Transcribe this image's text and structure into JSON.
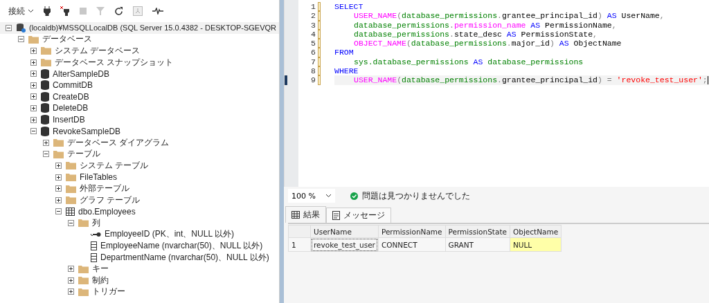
{
  "toolbar": {
    "connect_label": "接続"
  },
  "tree": [
    {
      "label": "(localdb)¥MSSQLLocalDB (SQL Server 15.0.4382 - DESKTOP-SGEVQR",
      "kind": "server",
      "expanded": true,
      "children": [
        {
          "label": "データベース",
          "kind": "folder",
          "expanded": true,
          "children": [
            {
              "label": "システム データベース",
              "kind": "folder",
              "expanded": false
            },
            {
              "label": "データベース スナップショット",
              "kind": "folder",
              "expanded": false
            },
            {
              "label": "AlterSampleDB",
              "kind": "database",
              "expanded": false
            },
            {
              "label": "CommitDB",
              "kind": "database",
              "expanded": false
            },
            {
              "label": "CreateDB",
              "kind": "database",
              "expanded": false
            },
            {
              "label": "DeleteDB",
              "kind": "database",
              "expanded": false
            },
            {
              "label": "InsertDB",
              "kind": "database",
              "expanded": false
            },
            {
              "label": "RevokeSampleDB",
              "kind": "database",
              "expanded": true,
              "children": [
                {
                  "label": "データベース ダイアグラム",
                  "kind": "folder",
                  "expanded": false
                },
                {
                  "label": "テーブル",
                  "kind": "folder",
                  "expanded": true,
                  "children": [
                    {
                      "label": "システム テーブル",
                      "kind": "folder",
                      "expanded": false
                    },
                    {
                      "label": "FileTables",
                      "kind": "folder",
                      "expanded": false
                    },
                    {
                      "label": "外部テーブル",
                      "kind": "folder",
                      "expanded": false
                    },
                    {
                      "label": "グラフ テーブル",
                      "kind": "folder",
                      "expanded": false
                    },
                    {
                      "label": "dbo.Employees",
                      "kind": "table",
                      "expanded": true,
                      "children": [
                        {
                          "label": "列",
                          "kind": "folder",
                          "expanded": true,
                          "children": [
                            {
                              "label": "EmployeeID (PK、int、NULL 以外)",
                              "kind": "key"
                            },
                            {
                              "label": "EmployeeName (nvarchar(50)、NULL 以外)",
                              "kind": "column"
                            },
                            {
                              "label": "DepartmentName (nvarchar(50)、NULL 以外)",
                              "kind": "column"
                            }
                          ]
                        },
                        {
                          "label": "キー",
                          "kind": "folder",
                          "expanded": false
                        },
                        {
                          "label": "制約",
                          "kind": "folder",
                          "expanded": false
                        },
                        {
                          "label": "トリガー",
                          "kind": "folder",
                          "expanded": false
                        }
                      ]
                    }
                  ]
                }
              ]
            }
          ]
        }
      ]
    }
  ],
  "editor": {
    "lines": [
      {
        "number": "1",
        "current": false,
        "indented": false,
        "tokens": [
          {
            "kind": "keyword",
            "text": "SELECT"
          }
        ]
      },
      {
        "number": "2",
        "current": false,
        "indented": true,
        "tokens": [
          {
            "kind": "function",
            "text": "USER_NAME"
          },
          {
            "kind": "op",
            "text": "("
          },
          {
            "kind": "ident",
            "text": "database_permissions"
          },
          {
            "kind": "op",
            "text": "."
          },
          {
            "kind": "plain",
            "text": "grantee_principal_id"
          },
          {
            "kind": "op",
            "text": ")"
          },
          {
            "kind": "keyword",
            "text": " AS"
          },
          {
            "kind": "plain",
            "text": " UserName"
          },
          {
            "kind": "op",
            "text": ","
          }
        ]
      },
      {
        "number": "3",
        "current": false,
        "indented": true,
        "tokens": [
          {
            "kind": "ident",
            "text": "database_permissions"
          },
          {
            "kind": "op",
            "text": "."
          },
          {
            "kind": "function",
            "text": "permission_name"
          },
          {
            "kind": "keyword",
            "text": " AS"
          },
          {
            "kind": "plain",
            "text": " PermissionName"
          },
          {
            "kind": "op",
            "text": ","
          }
        ]
      },
      {
        "number": "4",
        "current": false,
        "indented": true,
        "tokens": [
          {
            "kind": "ident",
            "text": "database_permissions"
          },
          {
            "kind": "op",
            "text": "."
          },
          {
            "kind": "plain",
            "text": "state_desc "
          },
          {
            "kind": "keyword",
            "text": "AS"
          },
          {
            "kind": "plain",
            "text": " PermissionState"
          },
          {
            "kind": "op",
            "text": ","
          }
        ]
      },
      {
        "number": "5",
        "current": false,
        "indented": true,
        "tokens": [
          {
            "kind": "function",
            "text": "OBJECT_NAME"
          },
          {
            "kind": "op",
            "text": "("
          },
          {
            "kind": "ident",
            "text": "database_permissions"
          },
          {
            "kind": "op",
            "text": "."
          },
          {
            "kind": "plain",
            "text": "major_id"
          },
          {
            "kind": "op",
            "text": ")"
          },
          {
            "kind": "keyword",
            "text": " AS"
          },
          {
            "kind": "plain",
            "text": " ObjectName"
          }
        ]
      },
      {
        "number": "6",
        "current": false,
        "indented": false,
        "tokens": [
          {
            "kind": "keyword",
            "text": "FROM"
          }
        ]
      },
      {
        "number": "7",
        "current": false,
        "indented": true,
        "tokens": [
          {
            "kind": "ident",
            "text": "sys.database_permissions "
          },
          {
            "kind": "keyword",
            "text": "AS"
          },
          {
            "kind": "ident",
            "text": " database_permissions"
          }
        ]
      },
      {
        "number": "8",
        "current": false,
        "indented": false,
        "tokens": [
          {
            "kind": "keyword",
            "text": "WHERE"
          }
        ]
      },
      {
        "number": "9",
        "current": true,
        "indented": true,
        "tokens": [
          {
            "kind": "function",
            "text": "USER_NAME"
          },
          {
            "kind": "op",
            "text": "("
          },
          {
            "kind": "ident",
            "text": "database_permissions"
          },
          {
            "kind": "op",
            "text": "."
          },
          {
            "kind": "plain",
            "text": "grantee_principal_id"
          },
          {
            "kind": "op",
            "text": ") ="
          },
          {
            "kind": "string",
            "text": " 'revoke_test_user'"
          },
          {
            "kind": "op",
            "text": ";"
          }
        ]
      }
    ]
  },
  "status": {
    "zoom": "100 %",
    "message": "問題は見つかりませんでした"
  },
  "result_tabs": [
    {
      "label": "結果",
      "selected": true
    },
    {
      "label": "メッセージ",
      "selected": false
    }
  ],
  "grid": {
    "columns": [
      "UserName",
      "PermissionName",
      "PermissionState",
      "ObjectName"
    ],
    "rows": [
      {
        "number": "1",
        "cells": [
          {
            "text": "revoke_test_user",
            "is_null": false,
            "focused": true
          },
          {
            "text": "CONNECT",
            "is_null": false,
            "focused": false
          },
          {
            "text": "GRANT",
            "is_null": false,
            "focused": false
          },
          {
            "text": "NULL",
            "is_null": true,
            "focused": false
          }
        ]
      }
    ]
  }
}
